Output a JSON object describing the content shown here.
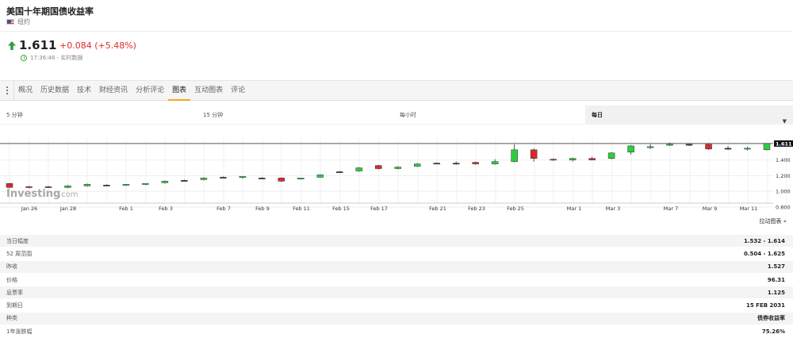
{
  "header": {
    "title": "美国十年期国债收益率",
    "region": "纽约"
  },
  "quote": {
    "last": "1.611",
    "change": "+0.084",
    "change_pct": "(+5.48%)",
    "time": "17:36:46 - 实时数据"
  },
  "tabs": [
    "概况",
    "历史数据",
    "技术",
    "财经资讯",
    "分析评论",
    "图表",
    "互动图表",
    "评论"
  ],
  "active_tab": 5,
  "intervals": {
    "i5m": "5 分钟",
    "i15m": "15 分钟",
    "hourly": "每小时",
    "daily": "每日",
    "arrow": "▼"
  },
  "colors": {
    "up": "#2ecc40",
    "down": "#d9292f",
    "neutral": "#333333",
    "accent": "#f5a623"
  },
  "chart_data": {
    "type": "candlestick",
    "brand": "Investing",
    "brand_suffix": ".com",
    "ylim": [
      0.85,
      1.68
    ],
    "y_ticks": [
      "1.400",
      "1.200",
      "1.000",
      "0.800"
    ],
    "current_label": "1.611",
    "x_ticks": [
      "Jan 26",
      "Jan 28",
      "Feb 1",
      "Feb 3",
      "Feb 7",
      "Feb 9",
      "Feb 11",
      "Feb 15",
      "Feb 17",
      "Feb 21",
      "Feb 23",
      "Feb 25",
      "Mar 1",
      "Mar 3",
      "Mar 7",
      "Mar 9",
      "Mar 11"
    ],
    "candles": [
      {
        "o": 1.1,
        "h": 1.11,
        "l": 1.04,
        "c": 1.05
      },
      {
        "o": 1.06,
        "h": 1.07,
        "l": 1.04,
        "c": 1.05
      },
      {
        "o": 1.06,
        "h": 1.07,
        "l": 1.04,
        "c": 1.05
      },
      {
        "o": 1.05,
        "h": 1.08,
        "l": 1.04,
        "c": 1.07
      },
      {
        "o": 1.07,
        "h": 1.1,
        "l": 1.06,
        "c": 1.09
      },
      {
        "o": 1.08,
        "h": 1.09,
        "l": 1.07,
        "c": 1.08
      },
      {
        "o": 1.08,
        "h": 1.09,
        "l": 1.07,
        "c": 1.09
      },
      {
        "o": 1.09,
        "h": 1.1,
        "l": 1.08,
        "c": 1.1
      },
      {
        "o": 1.11,
        "h": 1.14,
        "l": 1.1,
        "c": 1.13
      },
      {
        "o": 1.14,
        "h": 1.15,
        "l": 1.13,
        "c": 1.14
      },
      {
        "o": 1.15,
        "h": 1.18,
        "l": 1.14,
        "c": 1.17
      },
      {
        "o": 1.18,
        "h": 1.19,
        "l": 1.17,
        "c": 1.18
      },
      {
        "o": 1.18,
        "h": 1.19,
        "l": 1.16,
        "c": 1.19
      },
      {
        "o": 1.17,
        "h": 1.18,
        "l": 1.16,
        "c": 1.17
      },
      {
        "o": 1.17,
        "h": 1.18,
        "l": 1.12,
        "c": 1.13
      },
      {
        "o": 1.16,
        "h": 1.17,
        "l": 1.15,
        "c": 1.17
      },
      {
        "o": 1.18,
        "h": 1.22,
        "l": 1.17,
        "c": 1.21
      },
      {
        "o": 1.25,
        "h": 1.26,
        "l": 1.24,
        "c": 1.25
      },
      {
        "o": 1.26,
        "h": 1.31,
        "l": 1.25,
        "c": 1.3
      },
      {
        "o": 1.33,
        "h": 1.34,
        "l": 1.28,
        "c": 1.29
      },
      {
        "o": 1.29,
        "h": 1.32,
        "l": 1.28,
        "c": 1.31
      },
      {
        "o": 1.32,
        "h": 1.36,
        "l": 1.31,
        "c": 1.35
      },
      {
        "o": 1.36,
        "h": 1.37,
        "l": 1.35,
        "c": 1.36
      },
      {
        "o": 1.36,
        "h": 1.38,
        "l": 1.34,
        "c": 1.36
      },
      {
        "o": 1.37,
        "h": 1.38,
        "l": 1.34,
        "c": 1.35
      },
      {
        "o": 1.35,
        "h": 1.41,
        "l": 1.34,
        "c": 1.38
      },
      {
        "o": 1.38,
        "h": 1.6,
        "l": 1.37,
        "c": 1.53
      },
      {
        "o": 1.53,
        "h": 1.55,
        "l": 1.38,
        "c": 1.42
      },
      {
        "o": 1.41,
        "h": 1.42,
        "l": 1.39,
        "c": 1.4
      },
      {
        "o": 1.4,
        "h": 1.43,
        "l": 1.38,
        "c": 1.42
      },
      {
        "o": 1.42,
        "h": 1.44,
        "l": 1.4,
        "c": 1.4
      },
      {
        "o": 1.42,
        "h": 1.5,
        "l": 1.41,
        "c": 1.49
      },
      {
        "o": 1.5,
        "h": 1.59,
        "l": 1.47,
        "c": 1.58
      },
      {
        "o": 1.56,
        "h": 1.6,
        "l": 1.54,
        "c": 1.57
      },
      {
        "o": 1.59,
        "h": 1.62,
        "l": 1.58,
        "c": 1.6
      },
      {
        "o": 1.6,
        "h": 1.61,
        "l": 1.58,
        "c": 1.6
      },
      {
        "o": 1.6,
        "h": 1.61,
        "l": 1.53,
        "c": 1.54
      },
      {
        "o": 1.55,
        "h": 1.58,
        "l": 1.53,
        "c": 1.55
      },
      {
        "o": 1.54,
        "h": 1.57,
        "l": 1.52,
        "c": 1.55
      },
      {
        "o": 1.53,
        "h": 1.61,
        "l": 1.52,
        "c": 1.61
      }
    ]
  },
  "drag_chart": "拉动图表 »",
  "stats": [
    {
      "label": "当日幅度",
      "value": "1.532 - 1.614"
    },
    {
      "label": "52 周范围",
      "value": "0.504 - 1.625"
    },
    {
      "label": "昨收",
      "value": "1.527"
    },
    {
      "label": "价格",
      "value": "96.31"
    },
    {
      "label": "息票率",
      "value": "1.125"
    },
    {
      "label": "到期日",
      "value": "15 FEB 2031"
    },
    {
      "label": "种类",
      "value": "债券收益率"
    },
    {
      "label": "1年涨跌幅",
      "value": "75.26%"
    }
  ]
}
